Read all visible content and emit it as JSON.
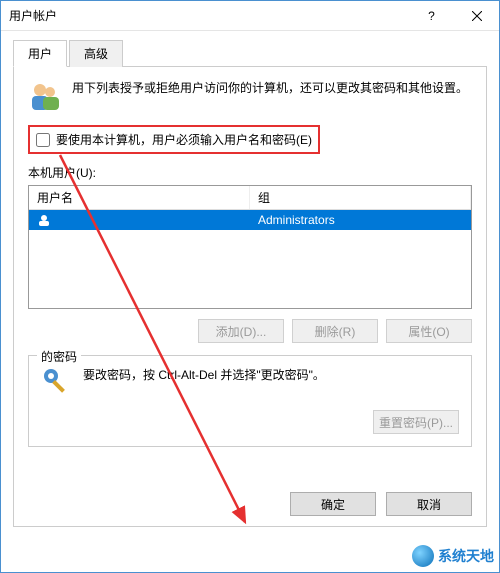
{
  "window": {
    "title": "用户帐户"
  },
  "tabs": [
    {
      "label": "用户",
      "active": true
    },
    {
      "label": "高级",
      "active": false
    }
  ],
  "intro": {
    "text": "用下列表授予或拒绝用户访问你的计算机，还可以更改其密码和其他设置。"
  },
  "checkbox": {
    "label": "要使用本计算机，用户必须输入用户名和密码(E)",
    "checked": false
  },
  "userlist": {
    "label": "本机用户(U):",
    "columns": {
      "name": "用户名",
      "group": "组"
    },
    "rows": [
      {
        "name": "",
        "group": "Administrators"
      }
    ]
  },
  "userButtons": {
    "add": "添加(D)...",
    "remove": "删除(R)",
    "properties": "属性(O)"
  },
  "passwordGroup": {
    "legend": "的密码",
    "desc": "要改密码，按 Ctrl-Alt-Del 并选择\"更改密码\"。",
    "reset": "重置密码(P)..."
  },
  "footer": {
    "ok": "确定",
    "cancel": "取消"
  },
  "watermark": {
    "text": "系统天地"
  }
}
